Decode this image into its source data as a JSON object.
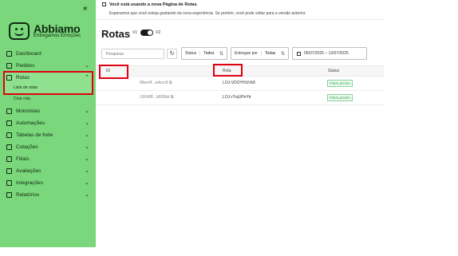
{
  "sidebar": {
    "collapse": "«",
    "brand": "Abbiamo",
    "tagline": "Entregamos Emoções",
    "items": [
      {
        "label": "Dashboard",
        "chevron": ""
      },
      {
        "label": "Pedidos",
        "chevron": "⌄"
      },
      {
        "label": "Rotas",
        "chevron": "⌃"
      },
      {
        "label": "Motoristas",
        "chevron": "⌄"
      },
      {
        "label": "Automações",
        "chevron": "⌄"
      },
      {
        "label": "Tabelas de frete",
        "chevron": "⌄"
      },
      {
        "label": "Cotações",
        "chevron": "⌄"
      },
      {
        "label": "Filiais",
        "chevron": "⌄"
      },
      {
        "label": "Avaliações",
        "chevron": "⌄"
      },
      {
        "label": "Integrações",
        "chevron": "⌄"
      },
      {
        "label": "Relatórios",
        "chevron": "⌄"
      }
    ],
    "sub_items": [
      "Lista de rotas",
      "Criar rota"
    ]
  },
  "banner": {
    "title": "Você está usando a nova Página de Rotas",
    "subtitle": "Esperamos que você esteja gostando da nova experiência. Se preferir, você pode voltar para a versão anterior."
  },
  "header": {
    "title": "Rotas",
    "v1": "V1",
    "v2": "V2"
  },
  "filters": {
    "search_placeholder": "Pesquisar",
    "refresh_icon": "↻",
    "status_label": "Status",
    "status_value": "Todos",
    "delivered_label": "Entregue por",
    "delivered_value": "Todas",
    "arrow": "⇅",
    "date_range": "05/07/2025 – 12/07/2025"
  },
  "table": {
    "columns": [
      "ID",
      "Rota",
      "Status"
    ],
    "rows": [
      {
        "id": "88ee4f...a4ecc8 ⧉",
        "rota": "LOJ-VDOYHUVk8",
        "status": "FINALIZADA"
      },
      {
        "id": "190488...b689bb ⧉",
        "rota": "LOJ-rTrqUPeYtr",
        "status": "FINALIZADA"
      }
    ]
  }
}
